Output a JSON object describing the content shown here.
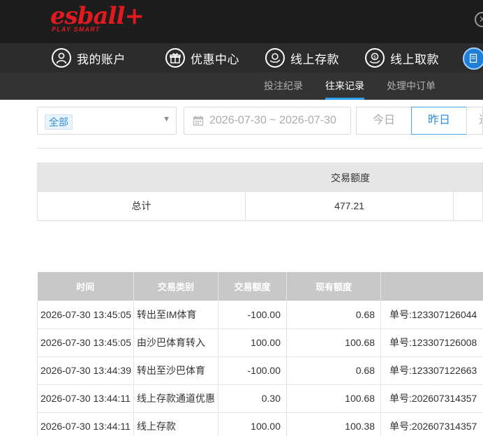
{
  "brand": {
    "name": "esball+",
    "tagline": "PLAY SMART",
    "color": "#e11a20"
  },
  "nav": {
    "items": [
      {
        "label": "我的账户",
        "icon": "user-icon"
      },
      {
        "label": "优惠中心",
        "icon": "gift-icon"
      },
      {
        "label": "线上存款",
        "icon": "deposit-icon"
      },
      {
        "label": "线上取款",
        "icon": "withdraw-icon"
      }
    ]
  },
  "subnav": {
    "tabs": [
      {
        "label": "投注纪录",
        "active": false
      },
      {
        "label": "往来记录",
        "active": true
      },
      {
        "label": "处理中订单",
        "active": false
      }
    ],
    "accent": "#2f9ce8"
  },
  "filters": {
    "type_selected": "全部",
    "date_range": "2026-07-30 ~ 2026-07-30",
    "quick": [
      {
        "label": "今日",
        "selected": false
      },
      {
        "label": "昨日",
        "selected": true
      },
      {
        "label": "近",
        "selected": false
      }
    ]
  },
  "summary": {
    "header": "交易额度",
    "row_label": "总计",
    "total": "477.21"
  },
  "transactions": {
    "headers": [
      "时间",
      "交易类别",
      "交易额度",
      "现有额度",
      ""
    ],
    "rows": [
      {
        "time": "2026-07-30 13:45:05",
        "type": "转出至IM体育",
        "amount": "-100.00",
        "balance": "0.68",
        "memo": "单号:123307126044"
      },
      {
        "time": "2026-07-30 13:45:05",
        "type": "由沙巴体育转入",
        "amount": "100.00",
        "balance": "100.68",
        "memo": "单号:123307126008"
      },
      {
        "time": "2026-07-30 13:44:39",
        "type": "转出至沙巴体育",
        "amount": "-100.00",
        "balance": "0.68",
        "memo": "单号:123307122663"
      },
      {
        "time": "2026-07-30 13:44:11",
        "type": "线上存款通道优惠",
        "amount": "0.30",
        "balance": "100.68",
        "memo": "单号:202607314357"
      },
      {
        "time": "2026-07-30 13:44:11",
        "type": "线上存款",
        "amount": "100.00",
        "balance": "100.38",
        "memo": "单号:202607314357"
      }
    ]
  }
}
